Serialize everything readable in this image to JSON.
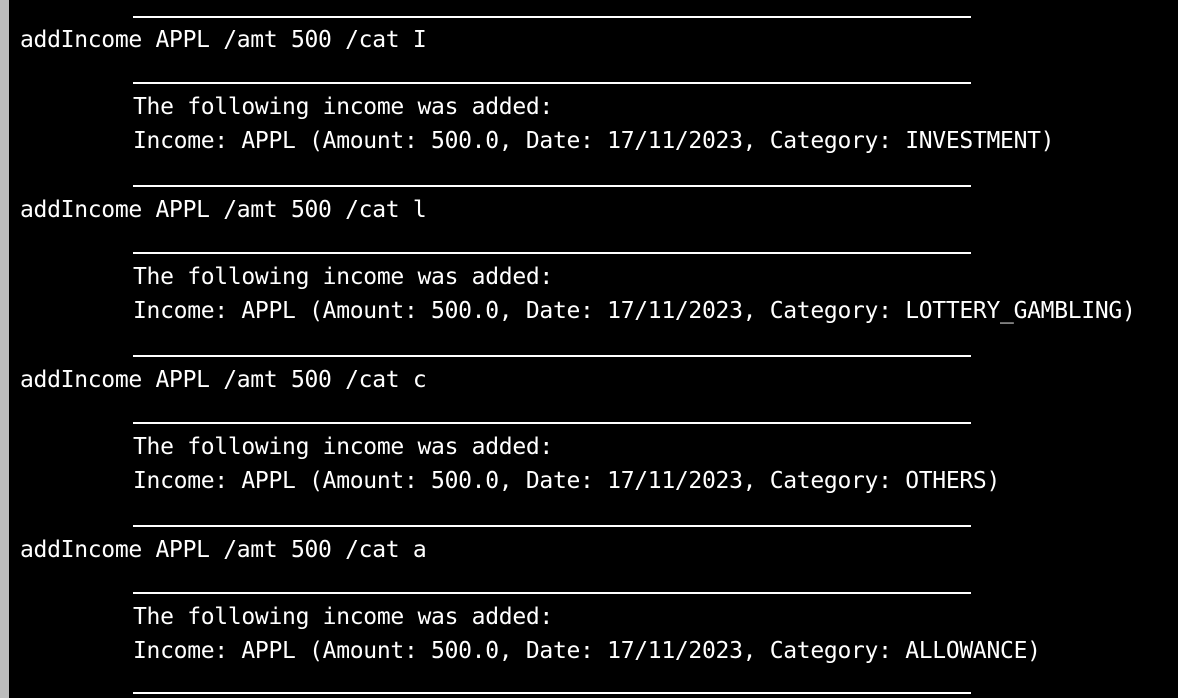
{
  "terminal": {
    "background": "#000000",
    "foreground": "#ffffff",
    "blocks": [
      {
        "command": "addIncome APPL /amt 500 /cat I",
        "message": "The following income was added:",
        "result": "Income: APPL (Amount: 500.0, Date: 17/11/2023, Category: INVESTMENT)"
      },
      {
        "command": "addIncome APPL /amt 500 /cat l",
        "message": "The following income was added:",
        "result": "Income: APPL (Amount: 500.0, Date: 17/11/2023, Category: LOTTERY_GAMBLING)"
      },
      {
        "command": "addIncome APPL /amt 500 /cat c",
        "message": "The following income was added:",
        "result": "Income: APPL (Amount: 500.0, Date: 17/11/2023, Category: OTHERS)"
      },
      {
        "command": "addIncome APPL /amt 500 /cat a",
        "message": "The following income was added:",
        "result": "Income: APPL (Amount: 500.0, Date: 17/11/2023, Category: ALLOWANCE)"
      }
    ]
  }
}
